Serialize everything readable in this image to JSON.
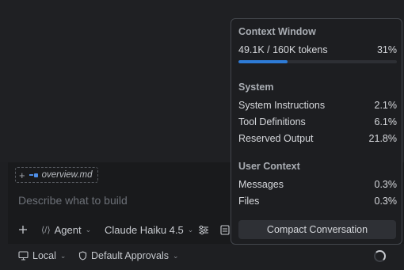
{
  "composer": {
    "attachment": {
      "file_name": "overview.md"
    },
    "placeholder": "Describe what to build",
    "toolbar": {
      "mode_label": "Agent",
      "model_label": "Claude Haiku 4.5"
    },
    "status": {
      "environment_label": "Local",
      "approvals_label": "Default Approvals"
    }
  },
  "context_popover": {
    "title": "Context Window",
    "usage_text": "49.1K / 160K tokens",
    "usage_percent_label": "31%",
    "usage_fraction": 0.31,
    "system_section": {
      "title": "System",
      "rows": [
        {
          "label": "System Instructions",
          "value": "2.1%"
        },
        {
          "label": "Tool Definitions",
          "value": "6.1%"
        },
        {
          "label": "Reserved Output",
          "value": "21.8%"
        }
      ]
    },
    "user_section": {
      "title": "User Context",
      "rows": [
        {
          "label": "Messages",
          "value": "0.3%"
        },
        {
          "label": "Files",
          "value": "0.3%"
        }
      ]
    },
    "compact_button_label": "Compact Conversation"
  },
  "colors": {
    "accent": "#2e7bd6",
    "file_icon": "#4f8fe8"
  }
}
